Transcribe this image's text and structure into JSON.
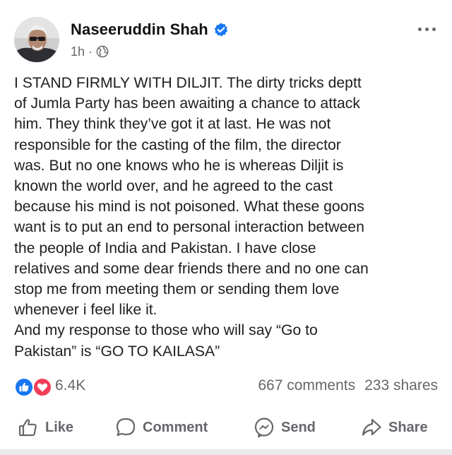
{
  "post": {
    "author": {
      "name": "Naseeruddin Shah",
      "avatar_icon": "avatar-photo",
      "verified_icon": "verified-badge-icon",
      "verified_color": "#1877f2"
    },
    "meta": {
      "time": "1h",
      "separator": "·",
      "audience_icon": "globe-icon"
    },
    "more_icon": "more-options-icon",
    "text_lines": [
      "I STAND FIRMLY WITH DILJIT. The dirty tricks deptt",
      "of Jumla Party has been awaiting a chance to attack",
      "him. They think they’ve got it at last. He was not",
      "responsible for the casting of the film, the director",
      "was. But no one knows who he is whereas Diljit is",
      "known the world over, and he agreed to the cast",
      "because his mind is not poisoned. What these goons",
      "want is to put an end to personal interaction between",
      "the people of India and Pakistan. I have close",
      "relatives and some dear friends there and no one can",
      "stop me from meeting them or sending them love",
      "whenever i feel like it.",
      "And my response to  those who will say “Go to",
      "Pakistan” is “GO TO KAILASA”"
    ],
    "stats": {
      "reaction_icons": [
        "like-reaction-icon",
        "love-reaction-icon"
      ],
      "reaction_colors": {
        "like": "#1877f2",
        "love": "#f33e58"
      },
      "reaction_count": "6.4K",
      "comments": "667 comments",
      "shares": "233 shares"
    },
    "actions": {
      "like": "Like",
      "comment": "Comment",
      "send": "Send",
      "share": "Share"
    }
  }
}
